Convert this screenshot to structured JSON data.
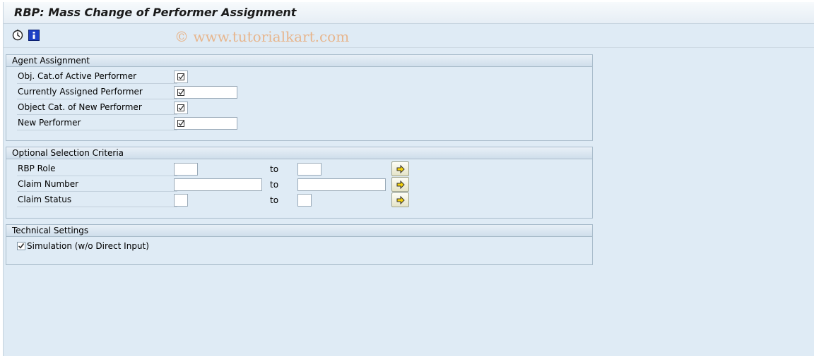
{
  "window": {
    "title": "RBP: Mass Change of Performer Assignment"
  },
  "toolbar": {
    "execute_icon": "execute-clock-icon",
    "info_icon": "info-icon",
    "watermark": "© www.tutorialkart.com"
  },
  "agent_assignment": {
    "header": "Agent Assignment",
    "rows": [
      {
        "label": "Obj. Cat.of Active Performer",
        "value": ""
      },
      {
        "label": "Currently Assigned Performer",
        "value": ""
      },
      {
        "label": "Object Cat. of New Performer",
        "value": ""
      },
      {
        "label": "New Performer",
        "value": ""
      }
    ]
  },
  "optional_selection": {
    "header": "Optional Selection Criteria",
    "to_label": "to",
    "rows": [
      {
        "label": "RBP Role",
        "from": "",
        "to": ""
      },
      {
        "label": "Claim Number",
        "from": "",
        "to": ""
      },
      {
        "label": "Claim Status",
        "from": "",
        "to": ""
      }
    ]
  },
  "technical_settings": {
    "header": "Technical Settings",
    "simulation_label": "Simulation (w/o Direct Input)",
    "simulation_checked": true
  },
  "colors": {
    "background": "#dfebf5",
    "group_border": "#a9bccb",
    "watermark": "#e7b58c"
  }
}
